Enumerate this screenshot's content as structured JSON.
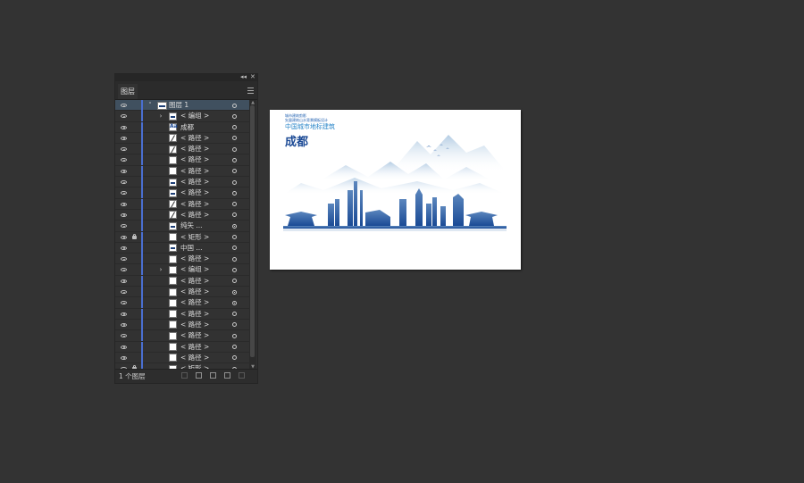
{
  "panel": {
    "tab_label": "图层",
    "collapse_glyph": "◂◂",
    "close_glyph": "✕",
    "footer_text": "1 个图层",
    "layer_color": "#4a6fd1"
  },
  "layers": [
    {
      "name": "图层 1",
      "kind": "layer",
      "expand": "˅",
      "thumb": "layer",
      "target": "ring"
    },
    {
      "name": "< 编组 >",
      "expand": "›",
      "thumb": "mark",
      "target": "ring"
    },
    {
      "name": "成都",
      "thumb": "text",
      "target": "ring"
    },
    {
      "name": "< 路径 >",
      "thumb": "diag",
      "target": "ring"
    },
    {
      "name": "< 路径 >",
      "thumb": "diag",
      "target": "ring"
    },
    {
      "name": "< 路径 >",
      "thumb": "blank",
      "target": "ring"
    },
    {
      "name": "< 路径 >",
      "thumb": "blank",
      "target": "ring"
    },
    {
      "name": "< 路径 >",
      "thumb": "mark",
      "target": "ring"
    },
    {
      "name": "< 路径 >",
      "thumb": "mark",
      "target": "ring"
    },
    {
      "name": "< 路径 >",
      "thumb": "diag",
      "target": "ring"
    },
    {
      "name": "< 路径 >",
      "thumb": "diag",
      "target": "ring"
    },
    {
      "name": "纯矢 ...",
      "thumb": "mark",
      "target": "filled"
    },
    {
      "name": "< 矩形 >",
      "thumb": "blank",
      "target": "ring",
      "locked": true
    },
    {
      "name": "中国 ...",
      "thumb": "mark",
      "target": "ring"
    },
    {
      "name": "< 路径 >",
      "thumb": "blank",
      "target": "ring"
    },
    {
      "name": "< 编组 >",
      "expand": "›",
      "thumb": "blank",
      "target": "ring"
    },
    {
      "name": "< 路径 >",
      "thumb": "blank",
      "target": "ring"
    },
    {
      "name": "< 路径 >",
      "thumb": "blank",
      "target": "filled"
    },
    {
      "name": "< 路径 >",
      "thumb": "blank",
      "target": "filled"
    },
    {
      "name": "< 路径 >",
      "thumb": "blank",
      "target": "ring"
    },
    {
      "name": "< 路径 >",
      "thumb": "blank",
      "target": "ring"
    },
    {
      "name": "< 路径 >",
      "thumb": "blank",
      "target": "ring"
    },
    {
      "name": "< 路径 >",
      "thumb": "blank",
      "target": "ring"
    },
    {
      "name": "< 路径 >",
      "thumb": "blank",
      "target": "ring"
    },
    {
      "name": "< 矩形 >",
      "thumb": "blank",
      "target": "ring",
      "locked": true
    }
  ],
  "artboard": {
    "small_text_1": "城市建筑剪影",
    "small_text_2": "矢量建筑山水背景模板设计",
    "subtitle": "中国城市地标建筑",
    "title": "成都",
    "accent": "#1d4b96"
  }
}
